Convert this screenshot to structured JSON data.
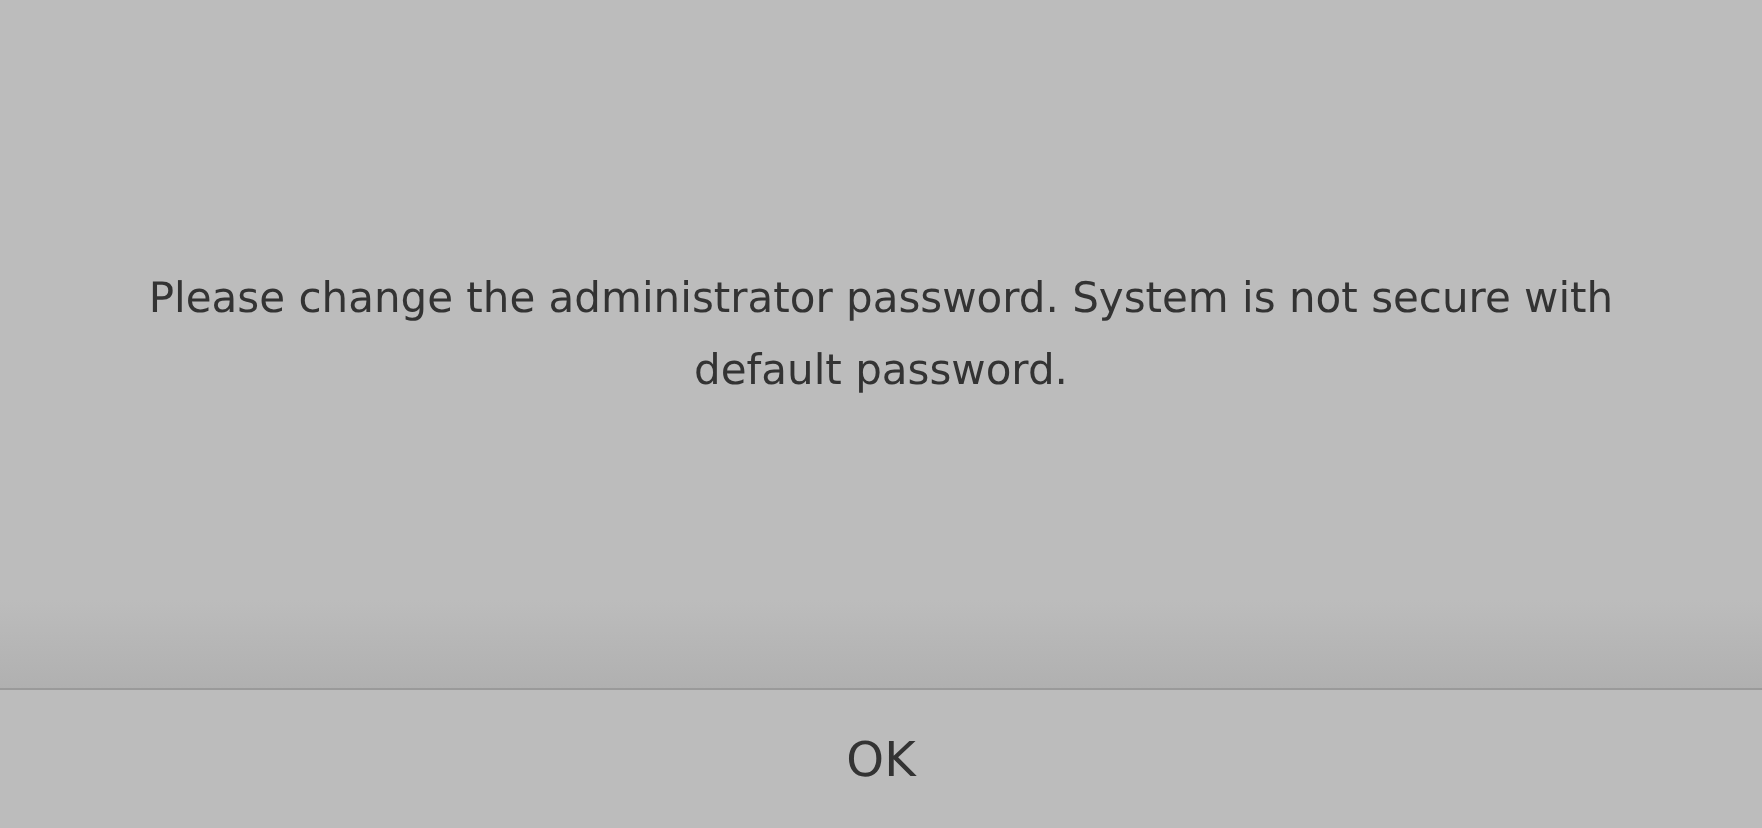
{
  "dialog": {
    "message": "Please change the administrator password. System is not secure with default password.",
    "buttons": [
      "OK"
    ]
  }
}
